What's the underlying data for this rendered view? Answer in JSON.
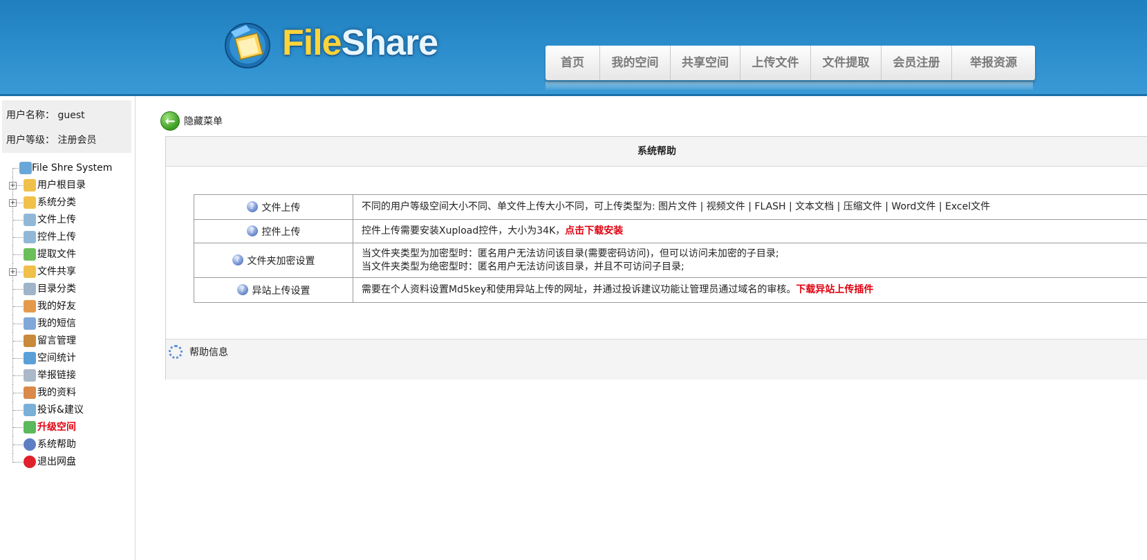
{
  "logo": {
    "part1": "File",
    "part2": "Share"
  },
  "nav": [
    "首页",
    "我的空间",
    "共享空间",
    "上传文件",
    "文件提取",
    "会员注册",
    "举报资源"
  ],
  "user": {
    "name_label": "用户名称：",
    "name_value": "guest",
    "level_label": "用户等级：",
    "level_value": "注册会员"
  },
  "tree": [
    {
      "label": "File Shre System",
      "icon": "system-icon",
      "expandable": false
    },
    {
      "label": "用户根目录",
      "icon": "folder-icon",
      "expandable": true
    },
    {
      "label": "系统分类",
      "icon": "folder-icon",
      "expandable": true
    },
    {
      "label": "文件上传",
      "icon": "upload-icon",
      "expandable": false
    },
    {
      "label": "控件上传",
      "icon": "upload-icon",
      "expandable": false
    },
    {
      "label": "提取文件",
      "icon": "extract-icon",
      "expandable": false
    },
    {
      "label": "文件共享",
      "icon": "share-folder-icon",
      "expandable": true
    },
    {
      "label": "目录分类",
      "icon": "list-icon",
      "expandable": false
    },
    {
      "label": "我的好友",
      "icon": "friends-icon",
      "expandable": false
    },
    {
      "label": "我的短信",
      "icon": "mail-icon",
      "expandable": false
    },
    {
      "label": "留言管理",
      "icon": "message-icon",
      "expandable": false
    },
    {
      "label": "空间统计",
      "icon": "stats-icon",
      "expandable": false
    },
    {
      "label": "举报链接",
      "icon": "report-icon",
      "expandable": false
    },
    {
      "label": "我的资料",
      "icon": "profile-icon",
      "expandable": false
    },
    {
      "label": "投诉&建议",
      "icon": "complaint-icon",
      "expandable": false
    },
    {
      "label": "升级空间",
      "icon": "upgrade-icon",
      "expandable": false,
      "highlight": true
    },
    {
      "label": "系统帮助",
      "icon": "help-icon",
      "expandable": false
    },
    {
      "label": "退出网盘",
      "icon": "exit-icon",
      "expandable": false
    }
  ],
  "hide_menu": {
    "label": "隐藏菜单"
  },
  "panel": {
    "title": "系统帮助",
    "rows": [
      {
        "topic": "文件上传",
        "lines": [
          "不同的用户等级空间大小不同、单文件上传大小不同，可上传类型为: 图片文件 | 视频文件 | FLASH | 文本文档 | 压缩文件 | Word文件 | Excel文件"
        ],
        "link": ""
      },
      {
        "topic": "控件上传",
        "lines": [
          "控件上传需要安装Xupload控件，大小为34K，"
        ],
        "link": "点击下载安装"
      },
      {
        "topic": "文件夹加密设置",
        "lines": [
          "当文件夹类型为加密型时：匿名用户无法访问该目录(需要密码访问)，但可以访问未加密的子目录;",
          "当文件夹类型为绝密型时：匿名用户无法访问该目录，并且不可访问子目录;"
        ],
        "link": ""
      },
      {
        "topic": "异站上传设置",
        "lines": [
          "需要在个人资料设置Md5key和使用异站上传的网址，并通过投诉建议功能让管理员通过域名的审核。"
        ],
        "link": "下载异站上传插件"
      }
    ],
    "info_label": "帮助信息"
  },
  "colors": {
    "header": "#2a8ccb",
    "highlight": "#e0000f",
    "nav_text": "#7a7a7a"
  }
}
